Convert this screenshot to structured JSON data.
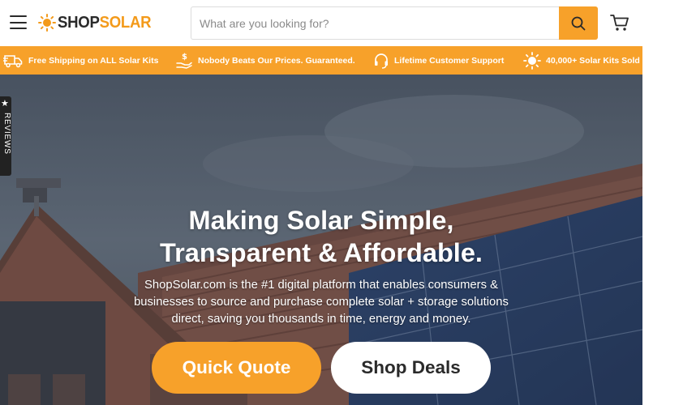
{
  "header": {
    "logo_shop": "SHOP",
    "logo_solar": "SOLAR",
    "search_placeholder": "What are you looking for?"
  },
  "promo": [
    {
      "label": "Free Shipping on ALL Solar Kits",
      "icon": "truck-icon"
    },
    {
      "label": "Nobody Beats Our Prices. Guaranteed.",
      "icon": "money-hand-icon"
    },
    {
      "label": "Lifetime Customer Support",
      "icon": "headset-icon"
    },
    {
      "label": "40,000+ Solar Kits Sold",
      "icon": "sun-icon"
    }
  ],
  "reviews_tab": {
    "label": "REVIEWS"
  },
  "hero": {
    "headline_line1": "Making Solar Simple,",
    "headline_line2": "Transparent & Affordable.",
    "sub_line1": "ShopSolar.com is the #1 digital platform that enables consumers &",
    "sub_line2": "businesses to source and purchase complete solar + storage solutions",
    "sub_line3": "direct, saving you thousands in time, energy and money.",
    "quote_button": "Quick Quote",
    "deals_button": "Shop Deals"
  },
  "colors": {
    "accent": "#f7a12a",
    "dark": "#2a2a2a"
  }
}
